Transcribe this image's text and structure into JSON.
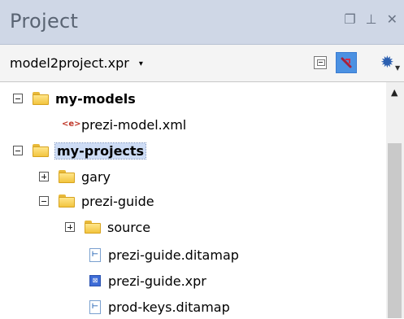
{
  "panel": {
    "title": "Project",
    "restore_icon": "restore-icon",
    "pin_icon": "pin-icon",
    "close_icon": "close-icon"
  },
  "toolbar": {
    "project_file": "model2project.xpr",
    "caret": "▾",
    "collapse_icon": "collapse-all-icon",
    "link_icon": "link-with-editor-icon",
    "settings_icon": "gear-icon"
  },
  "tree": {
    "items": [
      {
        "label": "my-models",
        "type": "folder",
        "expanded": true
      },
      {
        "label": "prezi-model.xml",
        "type": "xml-file"
      },
      {
        "label": "my-projects",
        "type": "folder",
        "expanded": true,
        "selected": true
      },
      {
        "label": "gary",
        "type": "folder",
        "expanded": false
      },
      {
        "label": "prezi-guide",
        "type": "folder",
        "expanded": true
      },
      {
        "label": "source",
        "type": "folder",
        "expanded": false
      },
      {
        "label": "prezi-guide.ditamap",
        "type": "ditamap-file"
      },
      {
        "label": "prezi-guide.xpr",
        "type": "xpr-file"
      },
      {
        "label": "prod-keys.ditamap",
        "type": "ditamap-file"
      }
    ]
  },
  "colors": {
    "titlebar": "#cfd7e6",
    "selection": "#cddcf5",
    "folder": "#f2c43f",
    "accent": "#4b91e2"
  }
}
